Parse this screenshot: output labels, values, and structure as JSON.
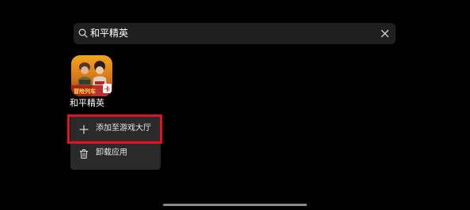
{
  "search": {
    "value": "和平精英",
    "placeholder": "",
    "icon": "search-icon",
    "clear_icon": "close-icon"
  },
  "app": {
    "name": "和平精英",
    "icon": "game-app-icon"
  },
  "context_menu": {
    "items": [
      {
        "label": "添加至游戏大厅",
        "icon": "plus-icon",
        "highlighted": true
      },
      {
        "label": "卸载应用",
        "icon": "trash-icon",
        "highlighted": false
      }
    ]
  },
  "colors": {
    "background": "#000000",
    "search_bg": "#1f1f1f",
    "menu_bg": "#2a2a2a",
    "highlight": "#e0141e",
    "text": "#ffffff"
  }
}
